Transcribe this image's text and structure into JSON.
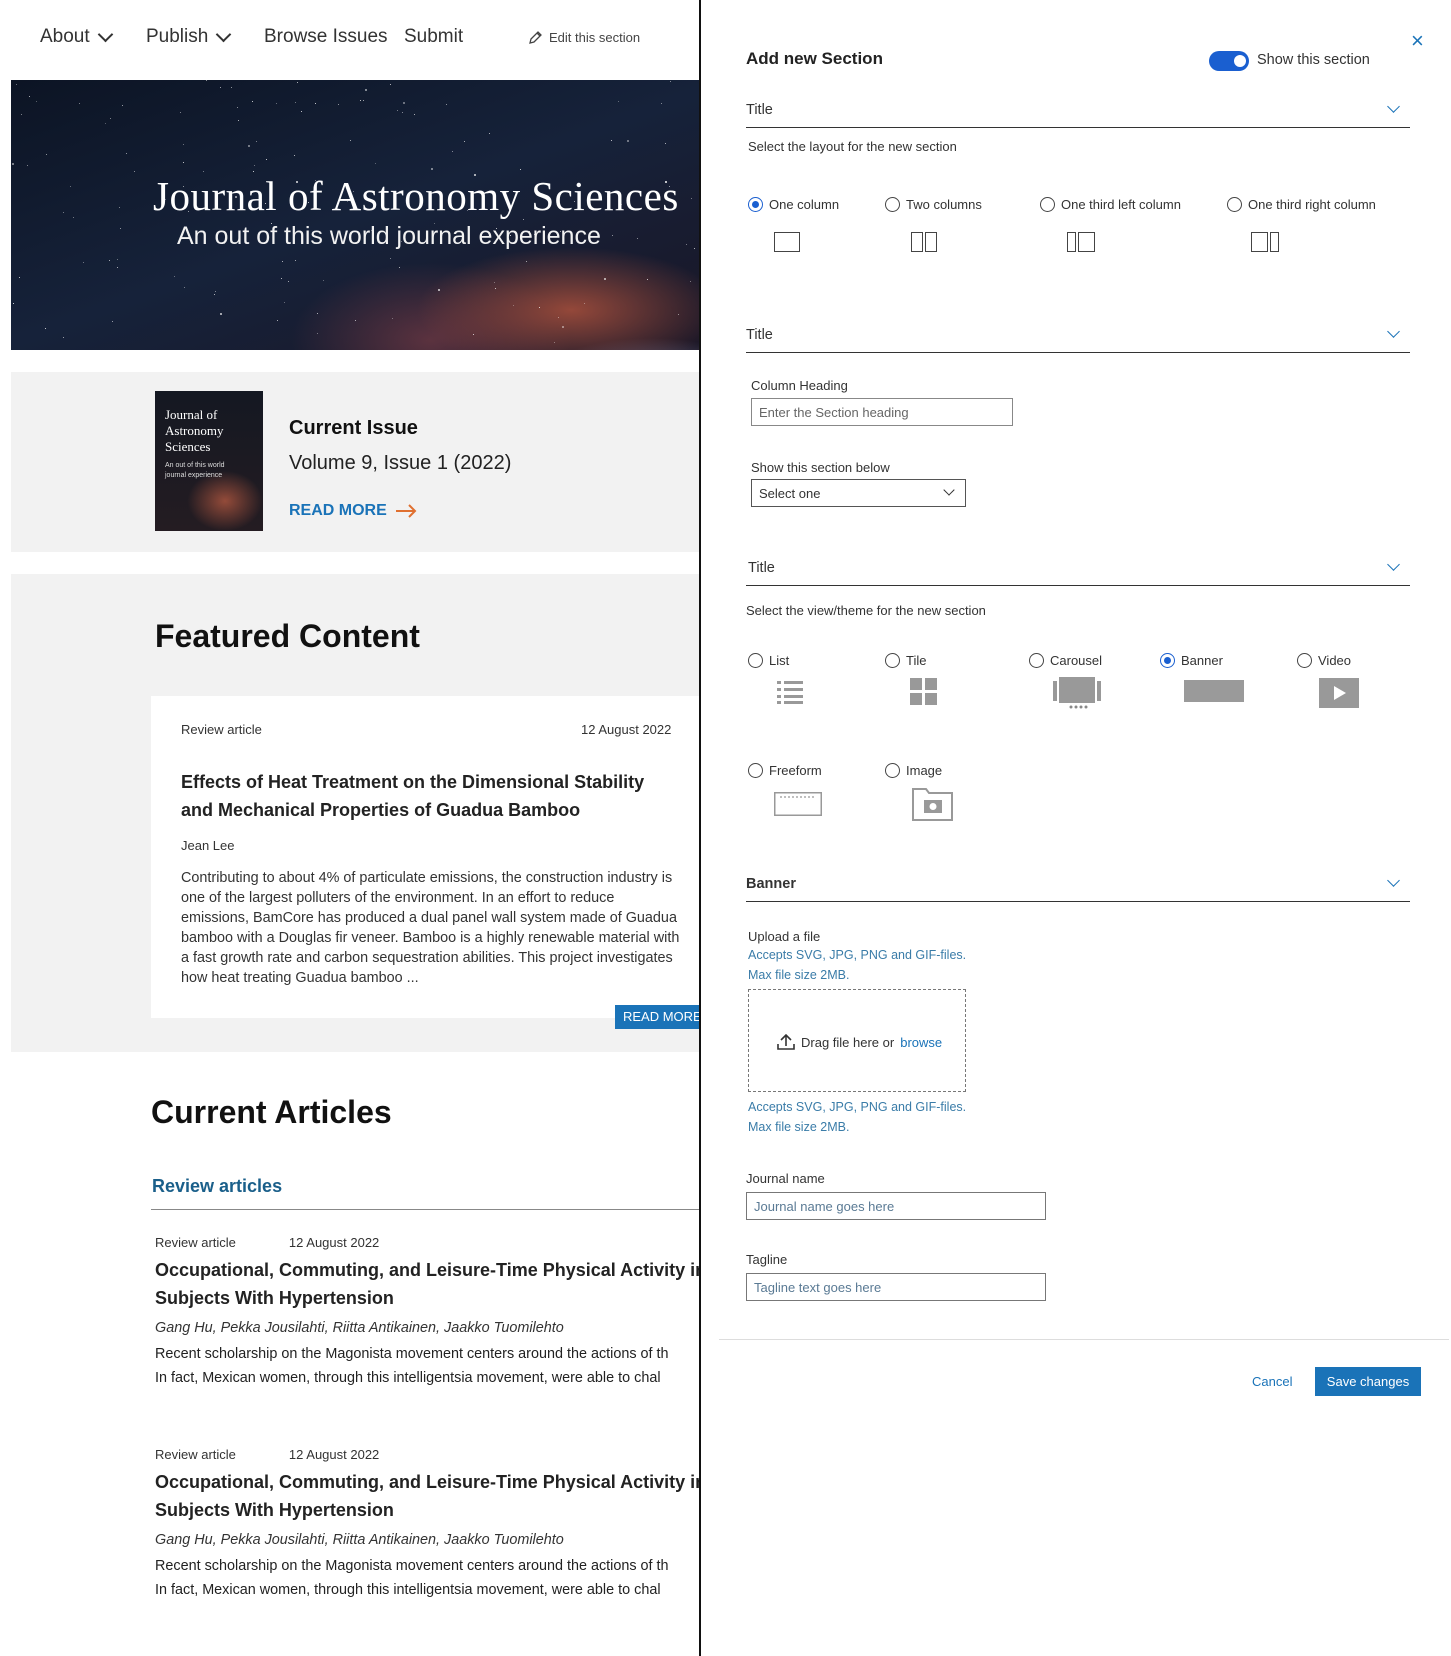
{
  "nav": {
    "items": [
      "About",
      "Publish",
      "Browse Issues",
      "Submit"
    ],
    "edit_label": "Edit this section"
  },
  "hero": {
    "title": "Journal of Astronomy Sciences",
    "tagline": "An out of this world journal experience"
  },
  "current_issue": {
    "cover_title": "Journal of Astronomy Sciences",
    "cover_tagline": "An out of this world journal experience",
    "label": "Current Issue",
    "volume": "Volume 9, Issue 1 (2022)",
    "read_more": "READ MORE"
  },
  "featured": {
    "heading": "Featured Content",
    "card": {
      "type": "Review article",
      "date": "12 August 2022",
      "title": "Effects of Heat Treatment on the Dimensional Stability and Mechanical Properties of Guadua Bamboo",
      "author": "Jean Lee",
      "abstract": "Contributing to about 4% of particulate emissions, the construction industry is one of the largest polluters of the environment. In an effort to reduce emissions, BamCore has produced a dual panel wall system made of Guadua bamboo with a Douglas fir veneer. Bamboo is a highly renewable material with a fast growth rate and carbon sequestration abilities. This project investigates how heat treating Guadua bamboo ..."
    },
    "read_more": "READ MORE"
  },
  "current_articles": {
    "heading": "Current Articles",
    "subheading": "Review articles",
    "articles": [
      {
        "type": "Review article",
        "date": "12 August 2022",
        "title_line1": "Occupational, Commuting, and Leisure-Time Physical Activity in F",
        "title_line2": "Subjects With Hypertension",
        "authors": "Gang Hu, Pekka Jousilahti, Riitta Antikainen, Jaakko Tuomilehto",
        "abstract_line1": "Recent scholarship on the Magonista movement centers around the actions of th",
        "abstract_line2": "In fact, Mexican women, through this intelligentsia movement, were able to chal"
      },
      {
        "type": "Review article",
        "date": "12 August 2022",
        "title_line1": "Occupational, Commuting, and Leisure-Time Physical Activity in F",
        "title_line2": "Subjects With Hypertension",
        "authors": "Gang Hu, Pekka Jousilahti, Riitta Antikainen, Jaakko Tuomilehto",
        "abstract_line1": "Recent scholarship on the Magonista movement centers around the actions of th",
        "abstract_line2": "In fact, Mexican women, through this intelligentsia movement, were able to chal"
      }
    ]
  },
  "panel": {
    "title": "Add new Section",
    "close": "×",
    "show_toggle_label": "Show this section",
    "show_toggle_on": true,
    "layout_section": {
      "accordion_title": "Title",
      "prompt": "Select the layout for the new section",
      "options": [
        "One column",
        "Two columns",
        "One third left column",
        "One third right column"
      ],
      "selected": "One column"
    },
    "heading_section": {
      "accordion_title": "Title",
      "column_heading_label": "Column Heading",
      "column_heading_placeholder": "Enter the Section heading",
      "show_below_label": "Show this section below",
      "show_below_value": "Select one"
    },
    "view_section": {
      "accordion_title": "Title",
      "prompt": "Select the view/theme for the new section",
      "options": [
        "List",
        "Tile",
        "Carousel",
        "Banner",
        "Video",
        "Freeform",
        "Image"
      ],
      "selected": "Banner"
    },
    "banner_section": {
      "accordion_title": "Banner",
      "upload_label": "Upload a file",
      "hint_line1": "Accepts SVG, JPG, PNG and GIF-files.",
      "hint_line2": "Max file size 2MB.",
      "drop_text": "Drag file here or",
      "browse": "browse",
      "journal_name_label": "Journal name",
      "journal_name_placeholder": "Journal name goes here",
      "tagline_label": "Tagline",
      "tagline_placeholder": "Tagline text goes here"
    },
    "cancel": "Cancel",
    "save": "Save changes"
  },
  "colors": {
    "accent": "#1a73b8",
    "toggle": "#1a5fd0",
    "arrow": "#e07030",
    "panel_bg": "#f2f2f2"
  }
}
